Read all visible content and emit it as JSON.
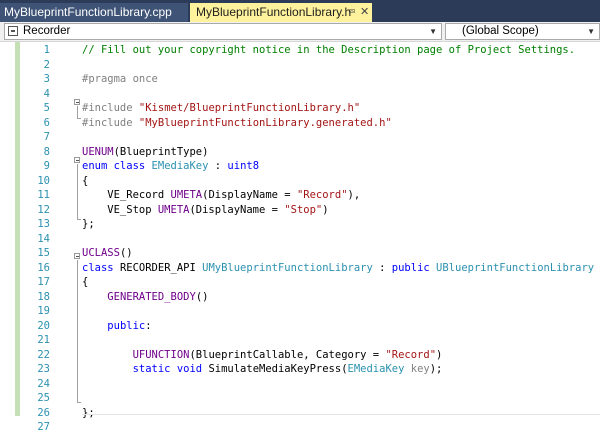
{
  "tabs": [
    {
      "label": "MyBlueprintFunctionLibrary.cpp",
      "active": false
    },
    {
      "label": "MyBlueprintFunctionLibrary.h",
      "active": true,
      "pin_icon": "pin-icon",
      "close_icon": "close-icon"
    }
  ],
  "navbar": {
    "project": "Recorder",
    "scope": "(Global Scope)"
  },
  "colors": {
    "keyword": "#0000ff",
    "macro": "#6f008a",
    "comment": "#008000",
    "string": "#a31515",
    "type": "#2b91af",
    "line_number": "#2b91af",
    "active_tab": "#fff29d"
  },
  "code_lines": [
    {
      "n": "1",
      "segs": [
        [
          "c",
          "// Fill out your copyright notice in the Description page of Project Settings."
        ]
      ]
    },
    {
      "n": "2",
      "segs": []
    },
    {
      "n": "3",
      "segs": [
        [
          "p",
          "#pragma once"
        ]
      ]
    },
    {
      "n": "4",
      "segs": []
    },
    {
      "n": "5",
      "segs": [
        [
          "p",
          "#include "
        ],
        [
          "s",
          "\"Kismet/BlueprintFunctionLibrary.h\""
        ]
      ]
    },
    {
      "n": "6",
      "segs": [
        [
          "p",
          "#include "
        ],
        [
          "s",
          "\"MyBlueprintFunctionLibrary.generated.h\""
        ]
      ]
    },
    {
      "n": "7",
      "segs": []
    },
    {
      "n": "8",
      "segs": [
        [
          "m",
          "UENUM"
        ],
        [
          "",
          "(BlueprintType)"
        ]
      ]
    },
    {
      "n": "9",
      "segs": [
        [
          "k",
          "enum class "
        ],
        [
          "t",
          "EMediaKey"
        ],
        [
          "",
          " : "
        ],
        [
          "k",
          "uint8"
        ]
      ]
    },
    {
      "n": "10",
      "segs": [
        [
          "",
          "{"
        ]
      ]
    },
    {
      "n": "11",
      "segs": [
        [
          "",
          "    VE_Record "
        ],
        [
          "m",
          "UMETA"
        ],
        [
          "",
          "(DisplayName = "
        ],
        [
          "s",
          "\"Record\""
        ],
        [
          "",
          "),"
        ]
      ]
    },
    {
      "n": "12",
      "segs": [
        [
          "",
          "    VE_Stop "
        ],
        [
          "m",
          "UMETA"
        ],
        [
          "",
          "(DisplayName = "
        ],
        [
          "s",
          "\"Stop\""
        ],
        [
          "",
          ")"
        ]
      ]
    },
    {
      "n": "13",
      "segs": [
        [
          "",
          "};"
        ]
      ]
    },
    {
      "n": "14",
      "segs": []
    },
    {
      "n": "15",
      "segs": [
        [
          "m",
          "UCLASS"
        ],
        [
          "",
          "()"
        ]
      ]
    },
    {
      "n": "16",
      "segs": [
        [
          "k",
          "class "
        ],
        [
          "",
          "RECORDER_API "
        ],
        [
          "t",
          "UMyBlueprintFunctionLibrary"
        ],
        [
          "",
          " : "
        ],
        [
          "k",
          "public "
        ],
        [
          "t",
          "UBlueprintFunctionLibrary"
        ]
      ]
    },
    {
      "n": "17",
      "segs": [
        [
          "",
          "{"
        ]
      ]
    },
    {
      "n": "18",
      "segs": [
        [
          "",
          "    "
        ],
        [
          "m",
          "GENERATED_BODY"
        ],
        [
          "",
          "()"
        ]
      ]
    },
    {
      "n": "19",
      "segs": []
    },
    {
      "n": "20",
      "segs": [
        [
          "",
          "    "
        ],
        [
          "k",
          "public"
        ],
        [
          "",
          ":"
        ]
      ]
    },
    {
      "n": "21",
      "segs": []
    },
    {
      "n": "22",
      "segs": [
        [
          "",
          "        "
        ],
        [
          "m",
          "UFUNCTION"
        ],
        [
          "",
          "(BlueprintCallable, Category = "
        ],
        [
          "s",
          "\"Record\""
        ],
        [
          "",
          ")"
        ]
      ]
    },
    {
      "n": "23",
      "segs": [
        [
          "",
          "        "
        ],
        [
          "k",
          "static void "
        ],
        [
          "",
          "SimulateMediaKeyPress("
        ],
        [
          "t",
          "EMediaKey"
        ],
        [
          "",
          " "
        ],
        [
          "p",
          "key"
        ],
        [
          "",
          ");"
        ]
      ]
    },
    {
      "n": "24",
      "segs": []
    },
    {
      "n": "25",
      "segs": []
    },
    {
      "n": "26",
      "segs": [
        [
          "",
          "};"
        ]
      ]
    },
    {
      "n": "27",
      "segs": []
    }
  ]
}
